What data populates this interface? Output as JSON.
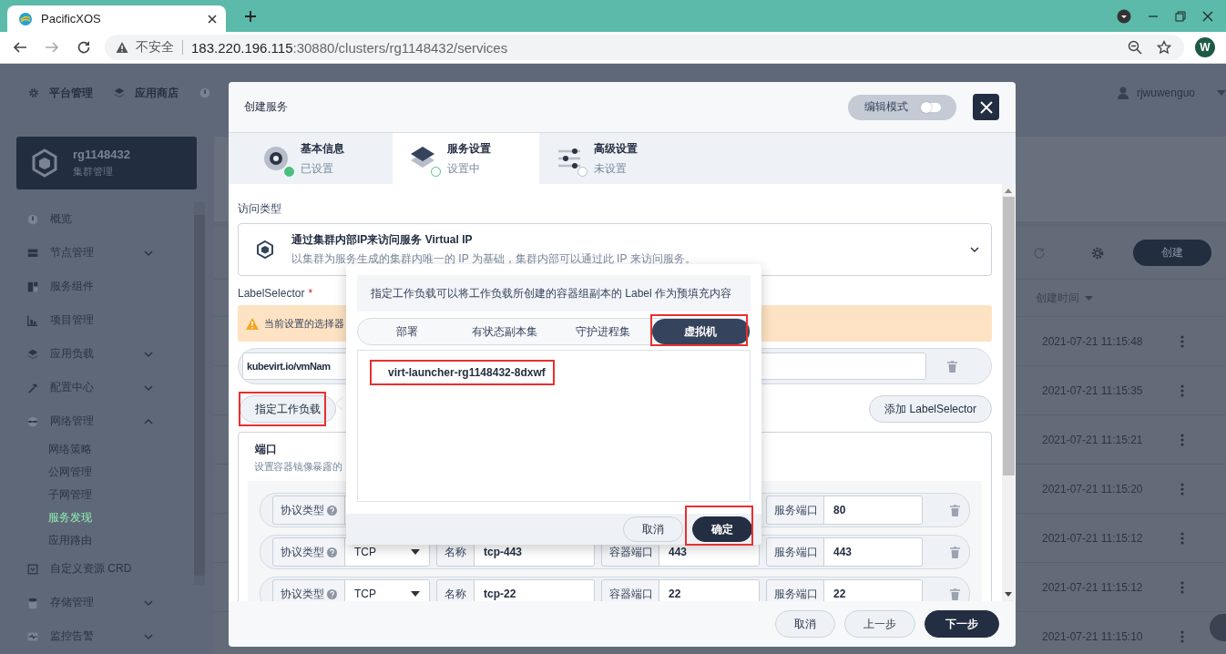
{
  "browser": {
    "tab_title": "PacificXOS",
    "security_label": "不安全",
    "url_host": "183.220.196.115",
    "url_rest": ":30880/clusters/rg1148432/services",
    "avatar_letter": "W"
  },
  "top_nav": {
    "items": [
      {
        "label": "平台管理"
      },
      {
        "label": "应用商店"
      }
    ],
    "user": "rjwuwenguo"
  },
  "cluster": {
    "name": "rg1148432",
    "subtitle": "集群管理"
  },
  "sidebar": {
    "items": [
      {
        "label": "概览",
        "selected": false
      },
      {
        "label": "节点管理",
        "selected": false,
        "expanded": false
      },
      {
        "label": "服务组件",
        "selected": false
      },
      {
        "label": "项目管理",
        "selected": false
      },
      {
        "label": "应用负载",
        "selected": false,
        "expanded": false
      },
      {
        "label": "配置中心",
        "selected": false,
        "expanded": false
      },
      {
        "label": "网络管理",
        "selected": false,
        "expanded": true,
        "children": [
          {
            "label": "网络策略",
            "selected": false
          },
          {
            "label": "公网管理",
            "selected": false
          },
          {
            "label": "子网管理",
            "selected": false
          },
          {
            "label": "服务发现",
            "selected": true
          },
          {
            "label": "应用路由",
            "selected": false
          }
        ]
      },
      {
        "label": "自定义资源 CRD",
        "selected": false
      },
      {
        "label": "存储管理",
        "selected": false,
        "expanded": false
      },
      {
        "label": "监控告警",
        "selected": false,
        "expanded": false
      }
    ]
  },
  "toolbar": {
    "create_button": "创建"
  },
  "table": {
    "columns": [
      {
        "label": "创建时间",
        "sortable": true
      }
    ],
    "rows": [
      {
        "created": "2021-07-21 11:15:48"
      },
      {
        "created": "2021-07-21 11:15:35"
      },
      {
        "created": "2021-07-21 11:15:21"
      },
      {
        "created": "2021-07-21 11:15:20"
      },
      {
        "created": "2021-07-21 11:15:12"
      },
      {
        "created": "2021-07-21 11:15:12"
      },
      {
        "created": "2021-07-21 11:15:10"
      }
    ]
  },
  "dialog": {
    "title": "创建服务",
    "edit_mode": {
      "label": "编辑模式",
      "on": false
    },
    "steps": [
      {
        "title": "基本信息",
        "subtitle": "已设置",
        "completed": true,
        "selected": false
      },
      {
        "title": "服务设置",
        "subtitle": "设置中",
        "completed": false,
        "selected": true
      },
      {
        "title": "高级设置",
        "subtitle": "未设置",
        "completed": false,
        "selected": false
      }
    ],
    "access_type": {
      "label": "访问类型",
      "title": "通过集群内部IP来访问服务 Virtual IP",
      "description": "以集群为服务生成的集群内唯一的 IP 为基础，集群内部可以通过此 IP 来访问服务。"
    },
    "label_selector": {
      "label": "LabelSelector",
      "required_mark": "*",
      "warning": "当前设置的选择器",
      "key_value": "kubevirt.io/vmNam"
    },
    "assign_button": {
      "label": "指定工作负载",
      "highlighted": true
    },
    "add_button": {
      "label": "添加 LabelSelector"
    },
    "ports": {
      "title": "端口",
      "description": "设置容器镜像暴露的",
      "rows": [
        {
          "protocol_label": "协议类型",
          "service_label": "服务端口",
          "service_port": "80"
        },
        {
          "protocol_label": "协议类型",
          "protocol": "TCP",
          "name_label": "名称",
          "name": "tcp-443",
          "container_label": "容器端口",
          "container_port": "443",
          "service_label": "服务端口",
          "service_port": "443"
        },
        {
          "protocol_label": "协议类型",
          "protocol": "TCP",
          "name_label": "名称",
          "name": "tcp-22",
          "container_label": "容器端口",
          "container_port": "22",
          "service_label": "服务端口",
          "service_port": "22"
        }
      ]
    },
    "footer_buttons": [
      {
        "label": "取消",
        "kind": "secondary"
      },
      {
        "label": "上一步",
        "kind": "secondary"
      },
      {
        "label": "下一步",
        "kind": "primary"
      }
    ]
  },
  "popover": {
    "hint": "指定工作负载可以将工作负载所创建的容器组副本的 Label 作为预填充内容",
    "tabs": [
      {
        "label": "部署",
        "selected": false,
        "highlighted": false
      },
      {
        "label": "有状态副本集",
        "selected": false,
        "highlighted": false
      },
      {
        "label": "守护进程集",
        "selected": false,
        "highlighted": false
      },
      {
        "label": "虚拟机",
        "selected": true,
        "highlighted": true
      }
    ],
    "items": [
      {
        "label": "virt-launcher-rg1148432-8dxwf",
        "highlighted": true
      }
    ],
    "buttons": [
      {
        "label": "取消",
        "kind": "secondary",
        "highlighted": false
      },
      {
        "label": "确定",
        "kind": "primary",
        "highlighted": true
      }
    ]
  }
}
